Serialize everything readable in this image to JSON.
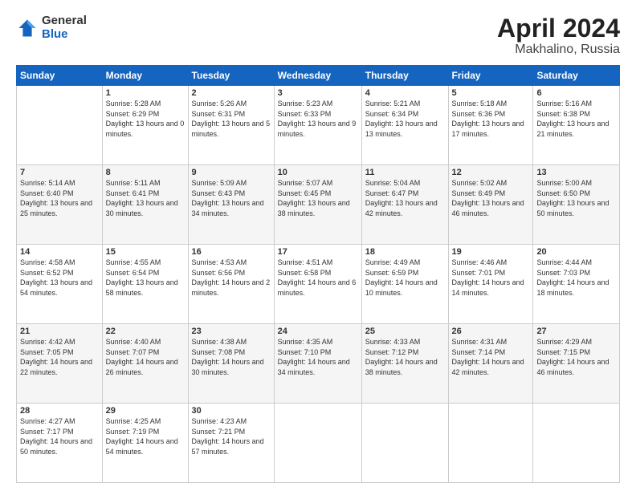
{
  "logo": {
    "general": "General",
    "blue": "Blue"
  },
  "header": {
    "month": "April 2024",
    "location": "Makhalino, Russia"
  },
  "weekdays": [
    "Sunday",
    "Monday",
    "Tuesday",
    "Wednesday",
    "Thursday",
    "Friday",
    "Saturday"
  ],
  "weeks": [
    [
      {
        "day": "",
        "sunrise": "",
        "sunset": "",
        "daylight": ""
      },
      {
        "day": "1",
        "sunrise": "Sunrise: 5:28 AM",
        "sunset": "Sunset: 6:29 PM",
        "daylight": "Daylight: 13 hours and 0 minutes."
      },
      {
        "day": "2",
        "sunrise": "Sunrise: 5:26 AM",
        "sunset": "Sunset: 6:31 PM",
        "daylight": "Daylight: 13 hours and 5 minutes."
      },
      {
        "day": "3",
        "sunrise": "Sunrise: 5:23 AM",
        "sunset": "Sunset: 6:33 PM",
        "daylight": "Daylight: 13 hours and 9 minutes."
      },
      {
        "day": "4",
        "sunrise": "Sunrise: 5:21 AM",
        "sunset": "Sunset: 6:34 PM",
        "daylight": "Daylight: 13 hours and 13 minutes."
      },
      {
        "day": "5",
        "sunrise": "Sunrise: 5:18 AM",
        "sunset": "Sunset: 6:36 PM",
        "daylight": "Daylight: 13 hours and 17 minutes."
      },
      {
        "day": "6",
        "sunrise": "Sunrise: 5:16 AM",
        "sunset": "Sunset: 6:38 PM",
        "daylight": "Daylight: 13 hours and 21 minutes."
      }
    ],
    [
      {
        "day": "7",
        "sunrise": "Sunrise: 5:14 AM",
        "sunset": "Sunset: 6:40 PM",
        "daylight": "Daylight: 13 hours and 25 minutes."
      },
      {
        "day": "8",
        "sunrise": "Sunrise: 5:11 AM",
        "sunset": "Sunset: 6:41 PM",
        "daylight": "Daylight: 13 hours and 30 minutes."
      },
      {
        "day": "9",
        "sunrise": "Sunrise: 5:09 AM",
        "sunset": "Sunset: 6:43 PM",
        "daylight": "Daylight: 13 hours and 34 minutes."
      },
      {
        "day": "10",
        "sunrise": "Sunrise: 5:07 AM",
        "sunset": "Sunset: 6:45 PM",
        "daylight": "Daylight: 13 hours and 38 minutes."
      },
      {
        "day": "11",
        "sunrise": "Sunrise: 5:04 AM",
        "sunset": "Sunset: 6:47 PM",
        "daylight": "Daylight: 13 hours and 42 minutes."
      },
      {
        "day": "12",
        "sunrise": "Sunrise: 5:02 AM",
        "sunset": "Sunset: 6:49 PM",
        "daylight": "Daylight: 13 hours and 46 minutes."
      },
      {
        "day": "13",
        "sunrise": "Sunrise: 5:00 AM",
        "sunset": "Sunset: 6:50 PM",
        "daylight": "Daylight: 13 hours and 50 minutes."
      }
    ],
    [
      {
        "day": "14",
        "sunrise": "Sunrise: 4:58 AM",
        "sunset": "Sunset: 6:52 PM",
        "daylight": "Daylight: 13 hours and 54 minutes."
      },
      {
        "day": "15",
        "sunrise": "Sunrise: 4:55 AM",
        "sunset": "Sunset: 6:54 PM",
        "daylight": "Daylight: 13 hours and 58 minutes."
      },
      {
        "day": "16",
        "sunrise": "Sunrise: 4:53 AM",
        "sunset": "Sunset: 6:56 PM",
        "daylight": "Daylight: 14 hours and 2 minutes."
      },
      {
        "day": "17",
        "sunrise": "Sunrise: 4:51 AM",
        "sunset": "Sunset: 6:58 PM",
        "daylight": "Daylight: 14 hours and 6 minutes."
      },
      {
        "day": "18",
        "sunrise": "Sunrise: 4:49 AM",
        "sunset": "Sunset: 6:59 PM",
        "daylight": "Daylight: 14 hours and 10 minutes."
      },
      {
        "day": "19",
        "sunrise": "Sunrise: 4:46 AM",
        "sunset": "Sunset: 7:01 PM",
        "daylight": "Daylight: 14 hours and 14 minutes."
      },
      {
        "day": "20",
        "sunrise": "Sunrise: 4:44 AM",
        "sunset": "Sunset: 7:03 PM",
        "daylight": "Daylight: 14 hours and 18 minutes."
      }
    ],
    [
      {
        "day": "21",
        "sunrise": "Sunrise: 4:42 AM",
        "sunset": "Sunset: 7:05 PM",
        "daylight": "Daylight: 14 hours and 22 minutes."
      },
      {
        "day": "22",
        "sunrise": "Sunrise: 4:40 AM",
        "sunset": "Sunset: 7:07 PM",
        "daylight": "Daylight: 14 hours and 26 minutes."
      },
      {
        "day": "23",
        "sunrise": "Sunrise: 4:38 AM",
        "sunset": "Sunset: 7:08 PM",
        "daylight": "Daylight: 14 hours and 30 minutes."
      },
      {
        "day": "24",
        "sunrise": "Sunrise: 4:35 AM",
        "sunset": "Sunset: 7:10 PM",
        "daylight": "Daylight: 14 hours and 34 minutes."
      },
      {
        "day": "25",
        "sunrise": "Sunrise: 4:33 AM",
        "sunset": "Sunset: 7:12 PM",
        "daylight": "Daylight: 14 hours and 38 minutes."
      },
      {
        "day": "26",
        "sunrise": "Sunrise: 4:31 AM",
        "sunset": "Sunset: 7:14 PM",
        "daylight": "Daylight: 14 hours and 42 minutes."
      },
      {
        "day": "27",
        "sunrise": "Sunrise: 4:29 AM",
        "sunset": "Sunset: 7:15 PM",
        "daylight": "Daylight: 14 hours and 46 minutes."
      }
    ],
    [
      {
        "day": "28",
        "sunrise": "Sunrise: 4:27 AM",
        "sunset": "Sunset: 7:17 PM",
        "daylight": "Daylight: 14 hours and 50 minutes."
      },
      {
        "day": "29",
        "sunrise": "Sunrise: 4:25 AM",
        "sunset": "Sunset: 7:19 PM",
        "daylight": "Daylight: 14 hours and 54 minutes."
      },
      {
        "day": "30",
        "sunrise": "Sunrise: 4:23 AM",
        "sunset": "Sunset: 7:21 PM",
        "daylight": "Daylight: 14 hours and 57 minutes."
      },
      {
        "day": "",
        "sunrise": "",
        "sunset": "",
        "daylight": ""
      },
      {
        "day": "",
        "sunrise": "",
        "sunset": "",
        "daylight": ""
      },
      {
        "day": "",
        "sunrise": "",
        "sunset": "",
        "daylight": ""
      },
      {
        "day": "",
        "sunrise": "",
        "sunset": "",
        "daylight": ""
      }
    ]
  ]
}
